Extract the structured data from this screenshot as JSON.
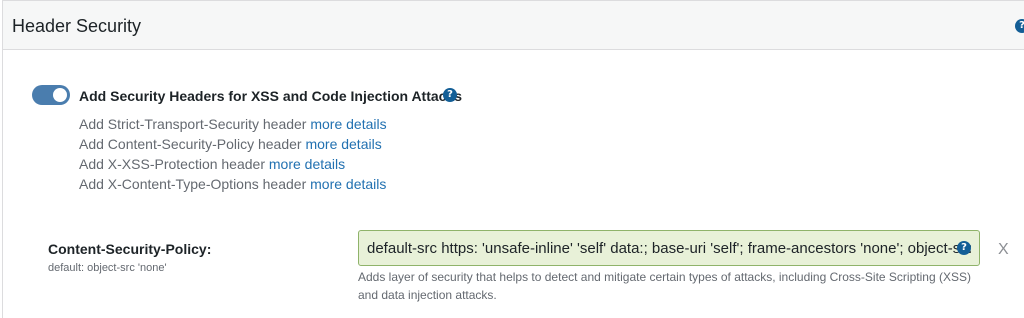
{
  "panel": {
    "title": "Header Security",
    "help_icon": "question-circle-icon"
  },
  "security_toggle": {
    "label": "Add Security Headers for XSS and Code Injection Attacks",
    "enabled": true,
    "help_icon": "question-circle-icon"
  },
  "headers": [
    {
      "text": "Add Strict-Transport-Security header",
      "link": "more details"
    },
    {
      "text": "Add Content-Security-Policy header",
      "link": "more details"
    },
    {
      "text": "Add X-XSS-Protection header",
      "link": "more details"
    },
    {
      "text": "Add X-Content-Type-Options header",
      "link": "more details"
    }
  ],
  "csp": {
    "label": "Content-Security-Policy:",
    "default": "default: object-src 'none'",
    "value": "default-src https: 'unsafe-inline' 'self' data:; base-uri 'self'; frame-ancestors 'none'; object-src 'none'",
    "description": "Adds layer of security that helps to detect and mitigate certain types of attacks, including Cross-Site Scripting (XSS) and data injection attacks.",
    "clear_label": "X",
    "input_bg_color": "#e8f1d8"
  },
  "colors": {
    "accent": "#2271b1",
    "toggle_on": "#4a7dae",
    "help_icon": "#135e96"
  }
}
